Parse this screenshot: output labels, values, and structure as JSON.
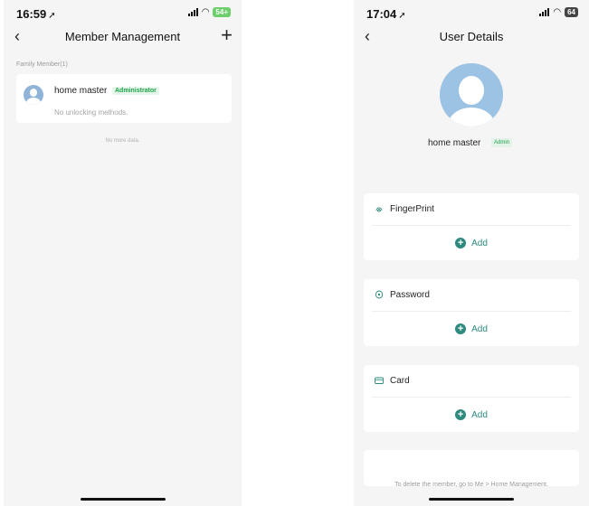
{
  "left": {
    "status": {
      "time": "16:59",
      "battery": "54+"
    },
    "nav": {
      "back": "‹",
      "title": "Member Management",
      "add": "+"
    },
    "section_label": "Family Member(1)",
    "member": {
      "name": "home master",
      "role": "Administrator",
      "methods": "No unlocking methods."
    },
    "no_more": "No more data."
  },
  "right": {
    "status": {
      "time": "17:04",
      "battery": "64"
    },
    "nav": {
      "back": "‹",
      "title": "User Details"
    },
    "profile": {
      "name": "home master",
      "role": "Admin"
    },
    "methods": [
      {
        "title": "FingerPrint",
        "icon": "fingerprint-icon",
        "add": "Add"
      },
      {
        "title": "Password",
        "icon": "password-icon",
        "add": "Add"
      },
      {
        "title": "Card",
        "icon": "card-icon",
        "add": "Add"
      }
    ],
    "footer": "To delete the member, go to Me > Home Management."
  },
  "colors": {
    "accent": "#2e8a7e",
    "admin_green": "#1ea24a",
    "background": "#f5f5f5"
  }
}
